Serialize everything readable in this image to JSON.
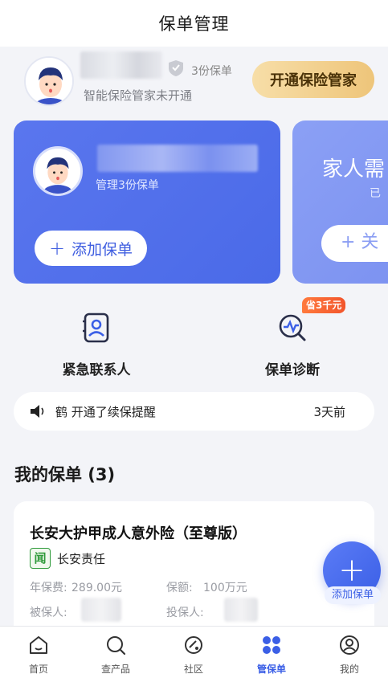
{
  "header": {
    "title": "保单管理"
  },
  "user": {
    "policy_count_label": "3份保单",
    "subtitle": "智能保险管家未开通",
    "butler_button": "开通保险管家"
  },
  "main_card": {
    "manage_label": "管理3份保单",
    "add_button": "添加保单"
  },
  "family_card": {
    "title": "家人需",
    "subtitle": "已"
  },
  "quick_actions": [
    {
      "label": "紧急联系人",
      "icon": "contact-card-icon"
    },
    {
      "label": "保单诊断",
      "icon": "diagnosis-icon",
      "badge": "省3千元"
    }
  ],
  "notice": {
    "text": "鹤 开通了续保提醒",
    "time": "3天前"
  },
  "my_policies": {
    "title": "我的保单 (3)"
  },
  "policy": {
    "name": "长安大护甲成人意外险（至尊版）",
    "insurer": "长安责任",
    "insurer_logo_char": "闻",
    "premium_label": "年保费:",
    "premium_value": "289.00元",
    "coverage_label": "保额:",
    "coverage_value": "100万元",
    "insured_label": "被保人:",
    "holder_label": "投保人:"
  },
  "fab": {
    "label": "添加保单"
  },
  "tabs": [
    {
      "label": "首页",
      "icon": "home-icon",
      "active": false
    },
    {
      "label": "查产品",
      "icon": "search-icon",
      "active": false
    },
    {
      "label": "社区",
      "icon": "community-icon",
      "active": false
    },
    {
      "label": "管保单",
      "icon": "policy-grid-icon",
      "active": true
    },
    {
      "label": "我的",
      "icon": "profile-icon",
      "active": false
    }
  ],
  "colors": {
    "accent": "#4a6ae8",
    "gold": "#eec57a",
    "badge": "#f2552c"
  }
}
